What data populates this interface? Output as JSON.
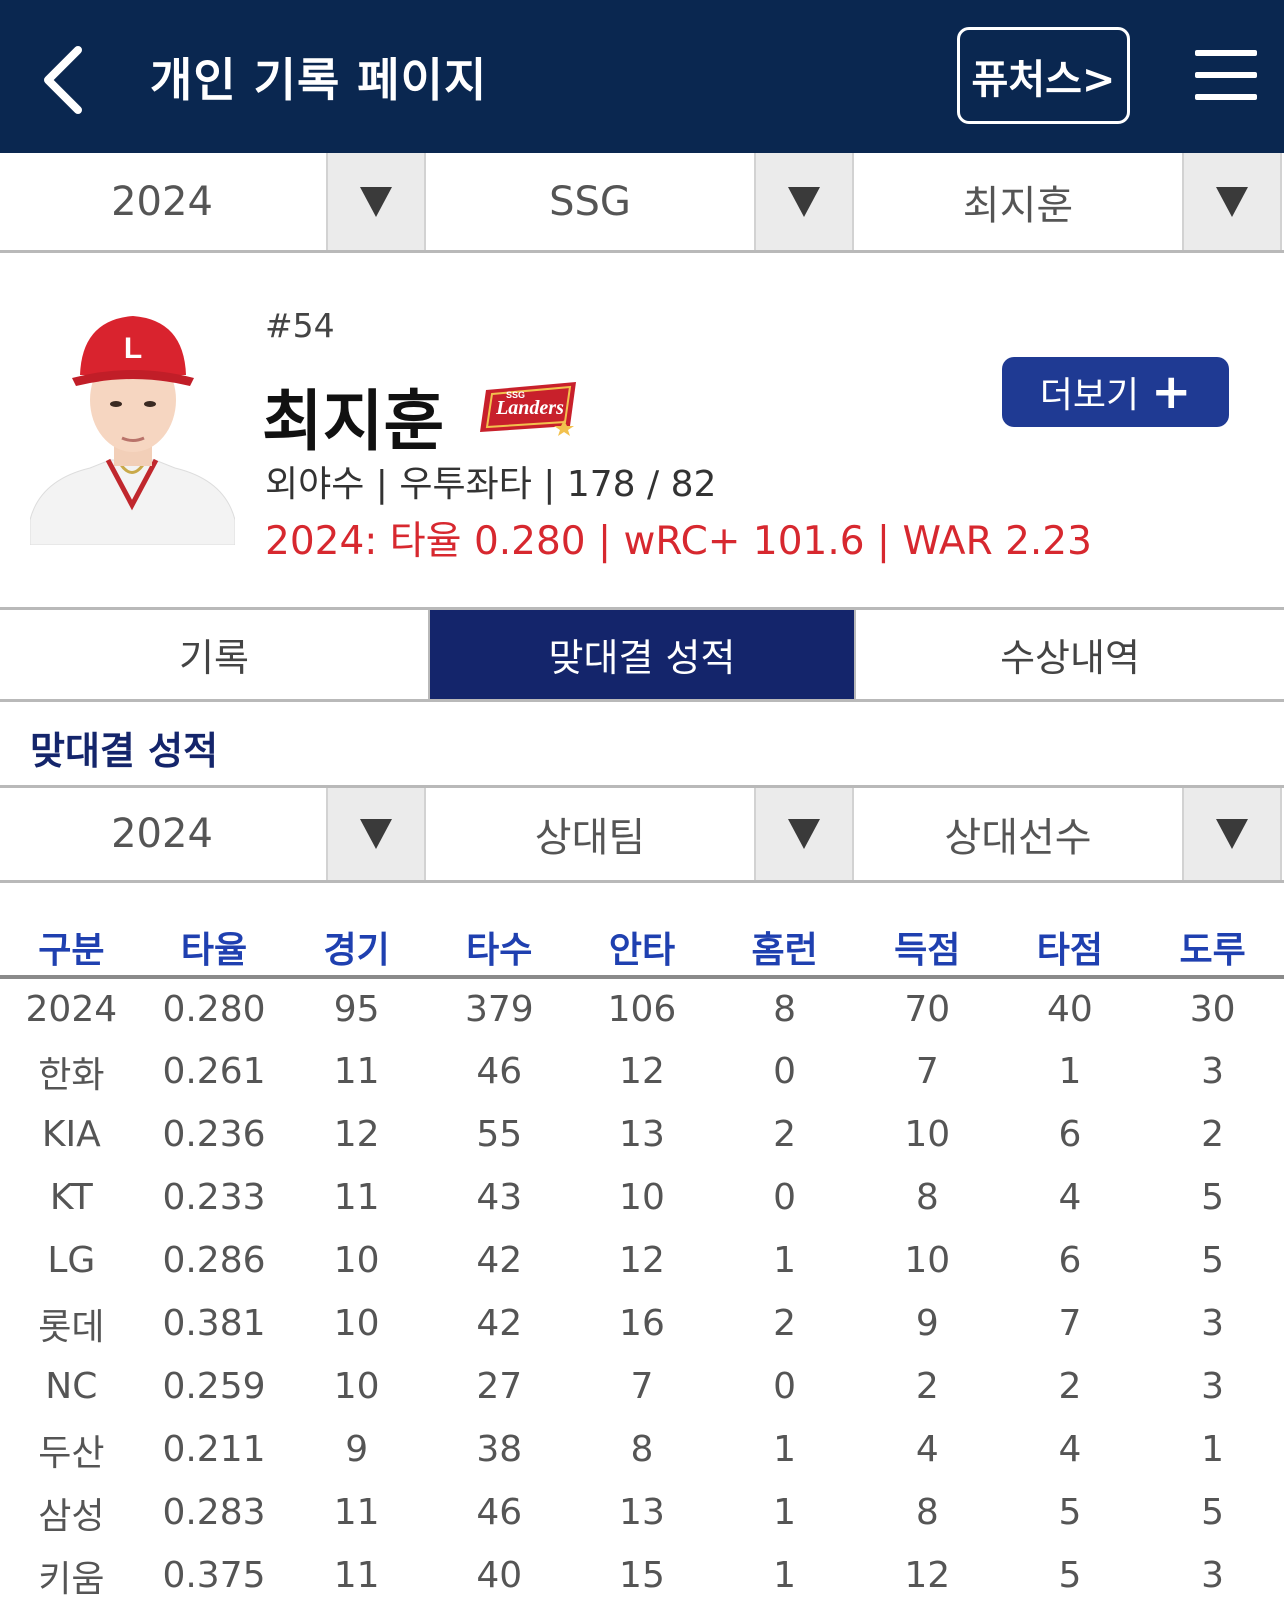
{
  "header": {
    "title": "개인 기록 페이지",
    "futures_label": "퓨처스>"
  },
  "filters": {
    "year": "2024",
    "team": "SSG",
    "player": "최지훈"
  },
  "player": {
    "number": "#54",
    "name": "최지훈",
    "team_logo_text": "SSG Landers",
    "info": "외야수 | 우투좌타 | 178 / 82",
    "season_stat": "2024: 타율 0.280 | wRC+ 101.6 | WAR 2.23",
    "more_label": "더보기",
    "more_icon": "plus-icon"
  },
  "tabs": [
    {
      "label": "기록",
      "active": false
    },
    {
      "label": "맞대결 성적",
      "active": true
    },
    {
      "label": "수상내역",
      "active": false
    }
  ],
  "section": {
    "title": "맞대결 성적",
    "filters": {
      "year": "2024",
      "opponent_team": "상대팀",
      "opponent_player": "상대선수"
    }
  },
  "table": {
    "headers": [
      "구분",
      "타율",
      "경기",
      "타수",
      "안타",
      "홈런",
      "득점",
      "타점",
      "도루"
    ],
    "rows": [
      [
        "2024",
        "0.280",
        "95",
        "379",
        "106",
        "8",
        "70",
        "40",
        "30"
      ],
      [
        "한화",
        "0.261",
        "11",
        "46",
        "12",
        "0",
        "7",
        "1",
        "3"
      ],
      [
        "KIA",
        "0.236",
        "12",
        "55",
        "13",
        "2",
        "10",
        "6",
        "2"
      ],
      [
        "KT",
        "0.233",
        "11",
        "43",
        "10",
        "0",
        "8",
        "4",
        "5"
      ],
      [
        "LG",
        "0.286",
        "10",
        "42",
        "12",
        "1",
        "10",
        "6",
        "5"
      ],
      [
        "롯데",
        "0.381",
        "10",
        "42",
        "16",
        "2",
        "9",
        "7",
        "3"
      ],
      [
        "NC",
        "0.259",
        "10",
        "27",
        "7",
        "0",
        "2",
        "2",
        "3"
      ],
      [
        "두산",
        "0.211",
        "9",
        "38",
        "8",
        "1",
        "4",
        "4",
        "1"
      ],
      [
        "삼성",
        "0.283",
        "11",
        "46",
        "13",
        "1",
        "8",
        "5",
        "5"
      ],
      [
        "키움",
        "0.375",
        "11",
        "40",
        "15",
        "1",
        "12",
        "5",
        "3"
      ]
    ]
  },
  "colors": {
    "header_bg": "#0a2750",
    "active_tab_bg": "#14256b",
    "more_btn_bg": "#1f3a93",
    "accent_red": "#d7282f",
    "table_header_text": "#1f40b0"
  }
}
